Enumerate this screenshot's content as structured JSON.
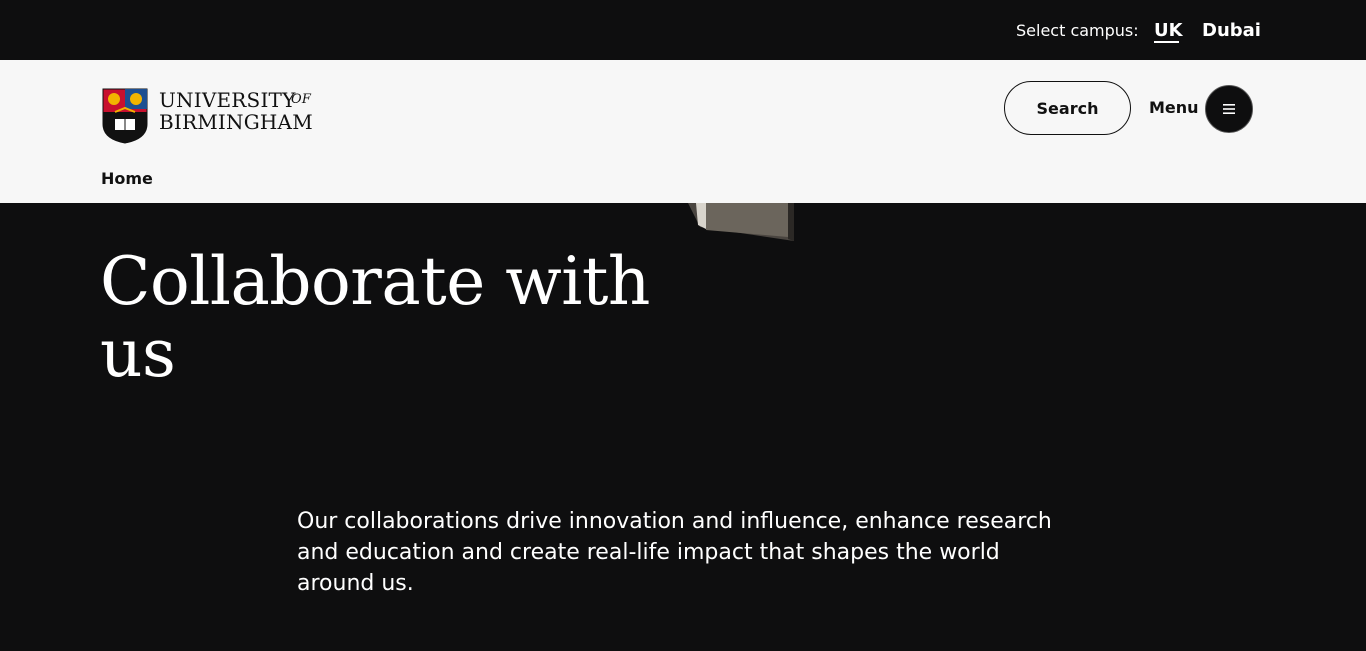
{
  "campus_bar": {
    "label": "Select campus:",
    "options": [
      {
        "label": "UK",
        "selected": true
      },
      {
        "label": "Dubai",
        "selected": false
      }
    ]
  },
  "header": {
    "logo": {
      "line1": "UNIVERSITY",
      "of": "OF",
      "line2": "BIRMINGHAM"
    },
    "search_label": "Search",
    "menu_label": "Menu",
    "menu_icon": "hamburger-icon"
  },
  "breadcrumb": {
    "items": [
      "Home"
    ]
  },
  "hero": {
    "title": "Collaborate with us",
    "intro": "Our collaborations drive innovation and influence, enhance research and education and create real-life impact that shapes the world around us."
  },
  "colors": {
    "page_background": "#0e0e0f",
    "header_background": "#f7f7f7",
    "text_light": "#ffffff",
    "text_dark": "#111111",
    "crest_red": "#c8102e",
    "crest_gold": "#f2b400",
    "crest_blue": "#1d4f91"
  }
}
